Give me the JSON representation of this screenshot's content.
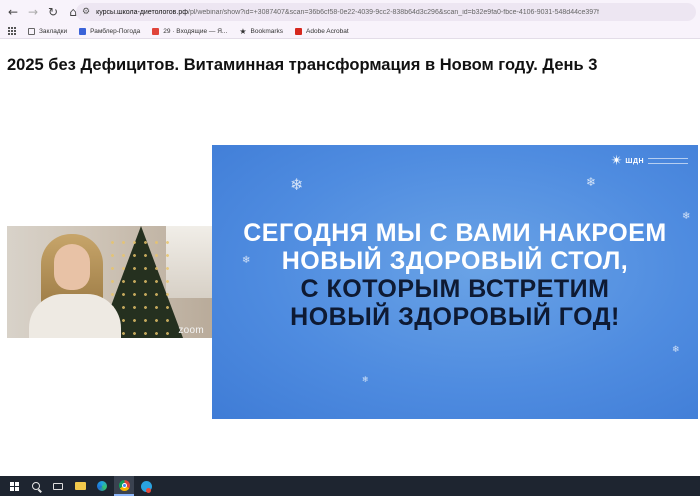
{
  "browser": {
    "nav": {
      "back_glyph": "←",
      "forward_glyph": "→",
      "reload_glyph": "↻",
      "home_glyph": "⌂"
    },
    "address_bar": {
      "site_info_glyph": "⚙",
      "url_host": "курсы.школа-диетологов.рф",
      "url_path": "/pl/webinar/show?id=+3087407&scan=36b6cf58-0e22-4039-9cc2-838b64d3c296&scan_id=b32e9fa0-fbce-4106-9031-548d44ce397f"
    },
    "bookmarks": [
      {
        "label": "Закладки",
        "icon": "folder-icon"
      },
      {
        "label": "Рамблер-Погода",
        "icon": "rambler-icon"
      },
      {
        "label": "29 · Входящие — Я...",
        "icon": "mail-icon"
      },
      {
        "label": "Bookmarks",
        "icon": "star-icon"
      },
      {
        "label": "Adobe Acrobat",
        "icon": "acrobat-icon"
      }
    ]
  },
  "page": {
    "title": "2025 без Дефицитов. Витаминная трансформация в Новом году. День 3"
  },
  "webcam": {
    "overlay_label": "zoom"
  },
  "slide": {
    "logo_star": "✴",
    "logo_text": "ШДН",
    "lines": [
      "СЕГОДНЯ МЫ С ВАМИ НАКРОЕМ",
      "НОВЫЙ ЗДОРОВЫЙ  СТОЛ,",
      "С КОТОРЫМ ВСТРЕТИМ",
      "НОВЫЙ ЗДОРОВЫЙ ГОД!"
    ],
    "colors": {
      "background": "#4f8ce0",
      "text_light": "#ffffff",
      "text_dark": "#0e1a33"
    }
  },
  "taskbar": {
    "items": [
      {
        "name": "start",
        "icon": "windows-logo-icon"
      },
      {
        "name": "search",
        "icon": "search-icon"
      },
      {
        "name": "widgets",
        "icon": "tv-icon"
      },
      {
        "name": "file-explorer",
        "icon": "folder-icon"
      },
      {
        "name": "edge",
        "icon": "edge-icon"
      },
      {
        "name": "chrome",
        "icon": "chrome-icon",
        "active": true
      },
      {
        "name": "telegram",
        "icon": "telegram-icon"
      }
    ]
  }
}
